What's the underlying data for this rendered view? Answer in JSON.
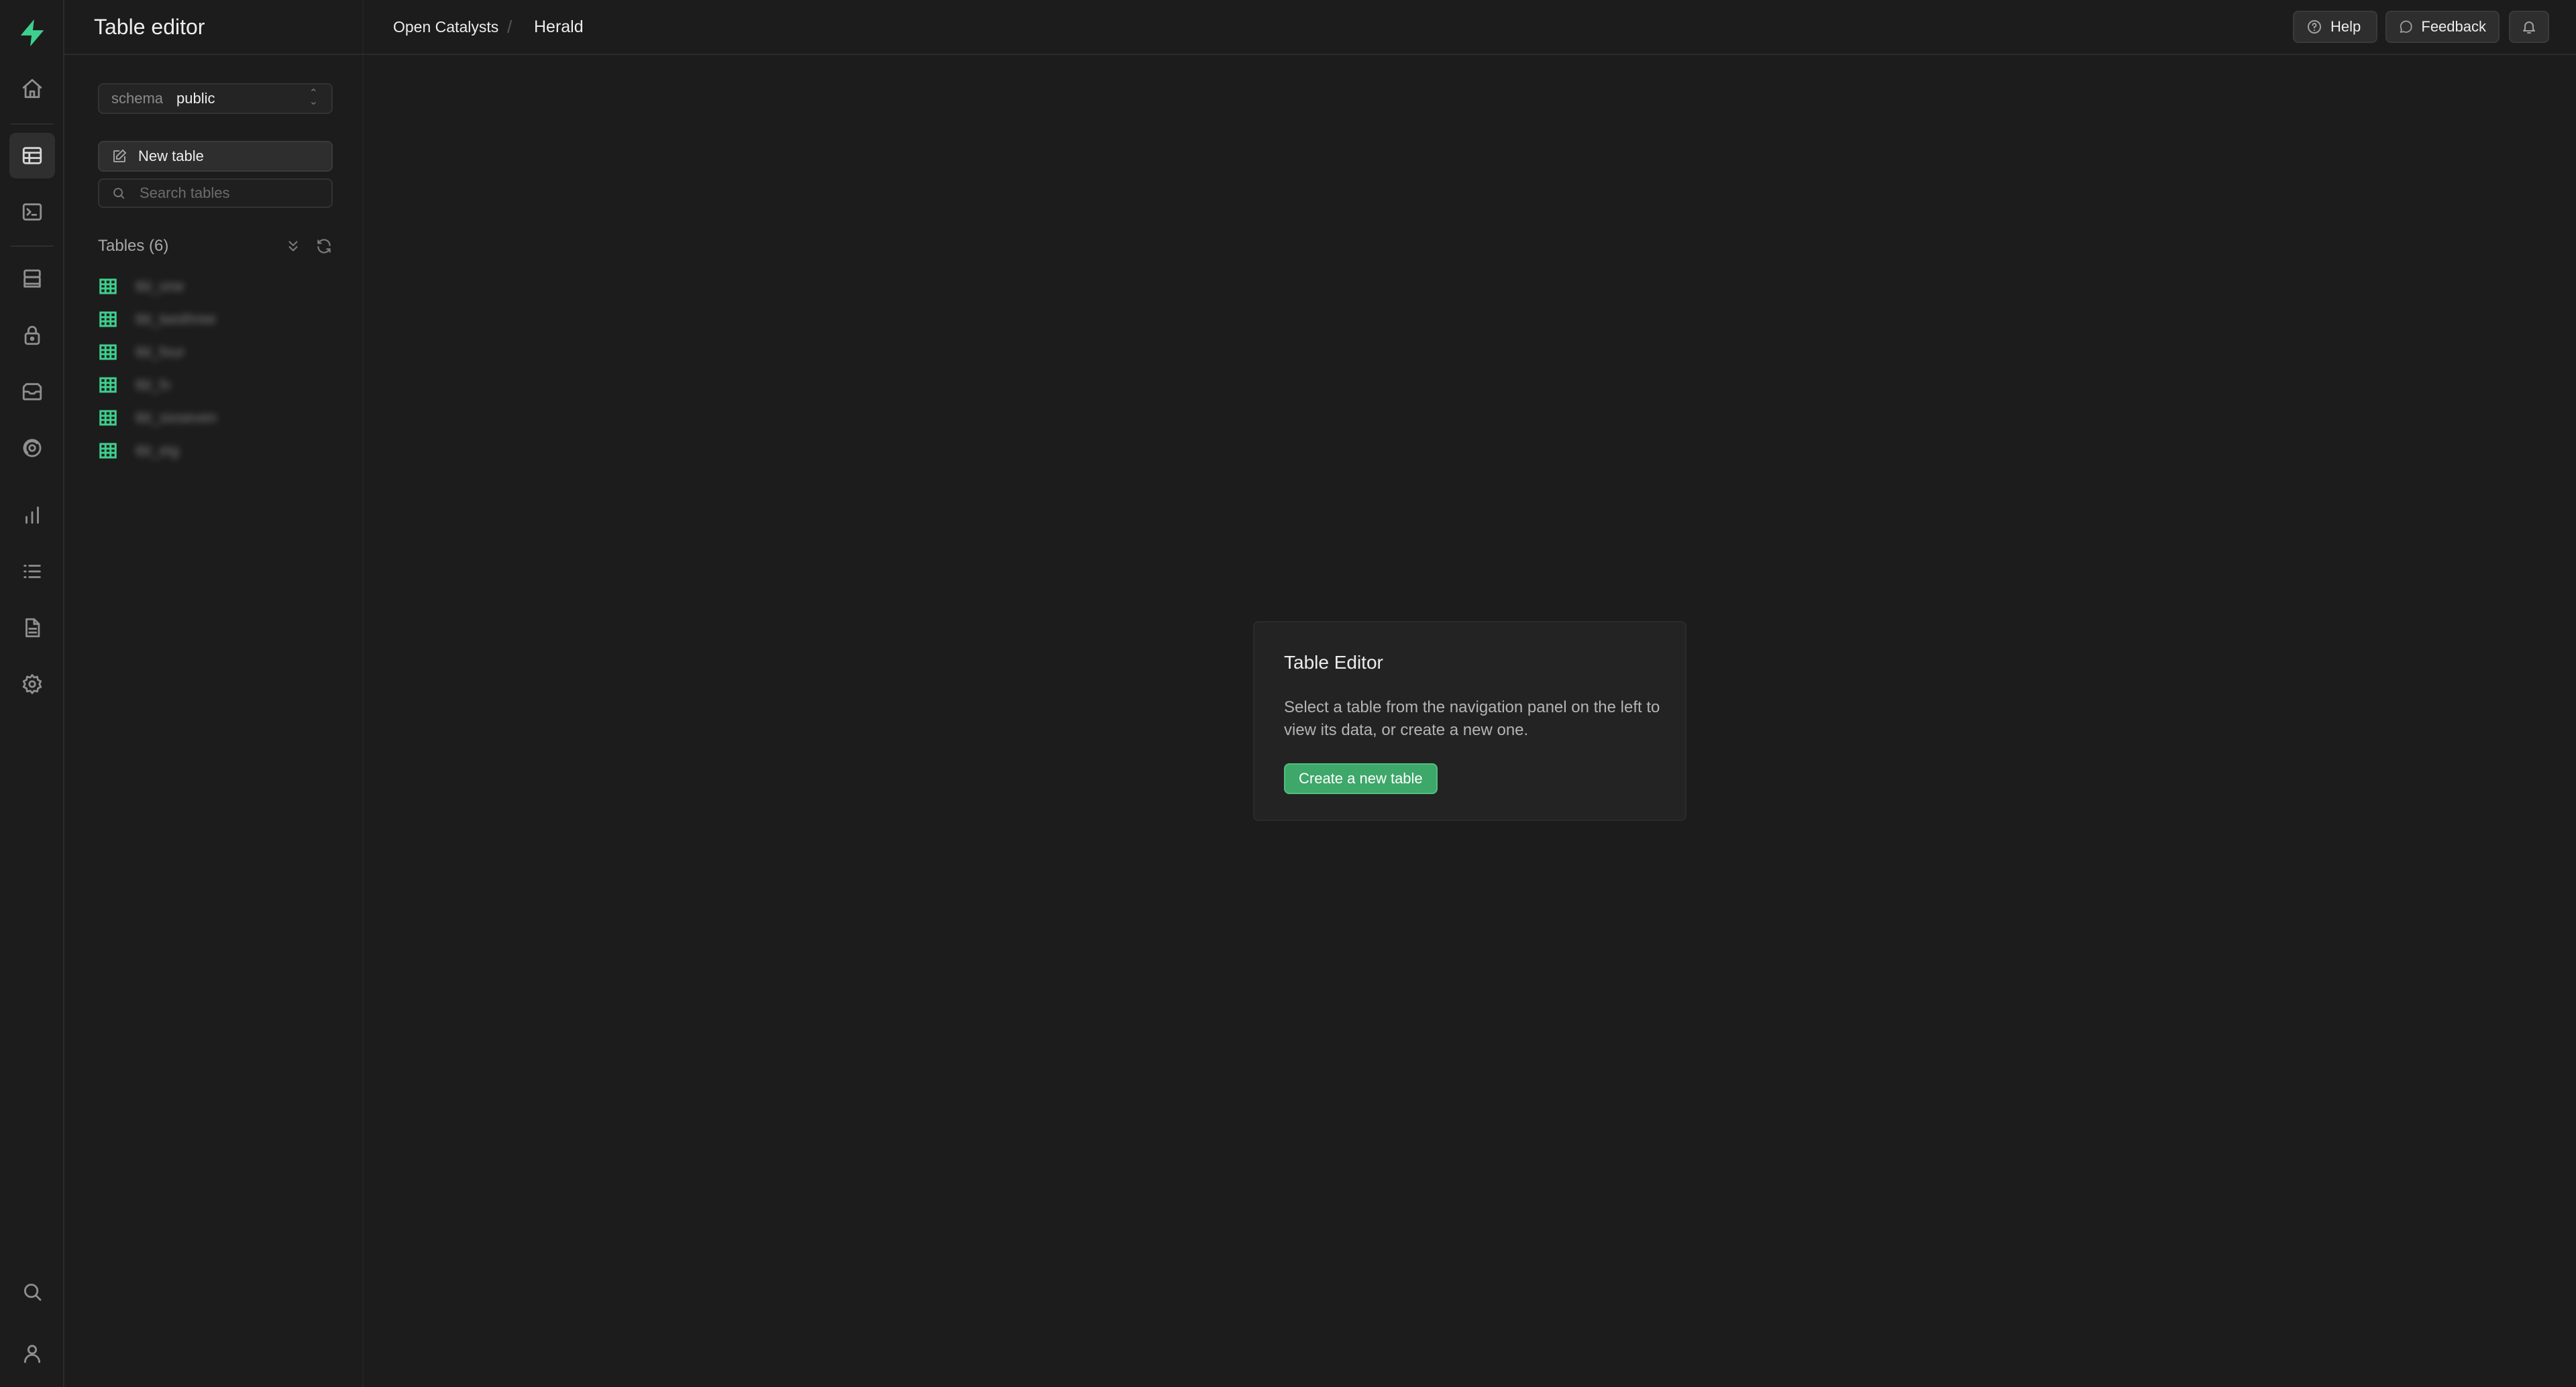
{
  "app": {
    "page_title": "Table editor",
    "accent_color": "#3ecf8e"
  },
  "breadcrumb": {
    "org": "Open Catalysts",
    "separator": "/",
    "project": "Herald"
  },
  "topbar": {
    "help_label": "Help",
    "feedback_label": "Feedback"
  },
  "rail": {
    "icons": [
      "home-icon",
      "table-editor-icon",
      "sql-editor-icon",
      "database-icon",
      "auth-lock-icon",
      "storage-icon",
      "realtime-icon",
      "reports-icon",
      "logs-icon",
      "docs-icon",
      "settings-icon",
      "search-icon",
      "user-icon"
    ]
  },
  "sidebar": {
    "schema_label": "schema",
    "schema_value": "public",
    "new_table_label": "New table",
    "search_placeholder": "Search tables",
    "tables_heading": "Tables (6)",
    "tables": [
      {
        "name": "tbl_one"
      },
      {
        "name": "tbl_twothree"
      },
      {
        "name": "tbl_four"
      },
      {
        "name": "tbl_fv"
      },
      {
        "name": "tbl_sixseven"
      },
      {
        "name": "tbl_eig"
      }
    ]
  },
  "empty_state": {
    "title": "Table Editor",
    "description": "Select a table from the navigation panel on the left to view its data, or create a new one.",
    "button_label": "Create a new table"
  }
}
